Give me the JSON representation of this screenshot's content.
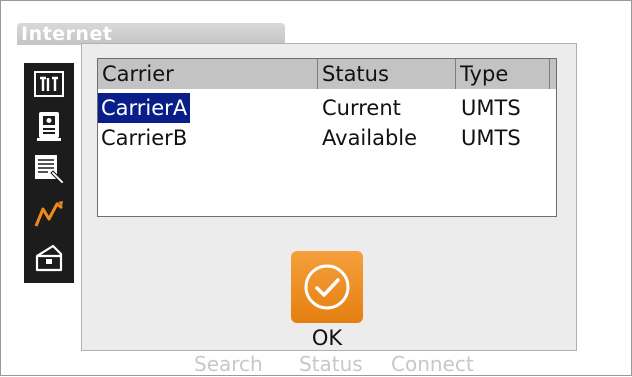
{
  "window": {
    "title": "Internet"
  },
  "sidebar": {
    "icons": [
      {
        "name": "measure-icon"
      },
      {
        "name": "instrument-icon"
      },
      {
        "name": "document-edit-icon"
      },
      {
        "name": "graph-icon"
      },
      {
        "name": "toolbox-icon"
      }
    ]
  },
  "bottom_bar": {
    "search_label": "Search",
    "status_label": "Status",
    "connect_label": "Connect"
  },
  "dialog": {
    "columns": [
      "Carrier",
      "Status",
      "Type"
    ],
    "rows": [
      {
        "carrier": "CarrierA",
        "status": "Current",
        "type": "UMTS",
        "selected": true
      },
      {
        "carrier": "CarrierB",
        "status": "Available",
        "type": "UMTS",
        "selected": false
      }
    ],
    "ok_label": "OK"
  },
  "colors": {
    "accent_orange": "#e88a1a",
    "selection_blue": "#0a1e8a",
    "header_gray": "#c3c3c3",
    "toolbar_black": "#1c1c1c"
  }
}
